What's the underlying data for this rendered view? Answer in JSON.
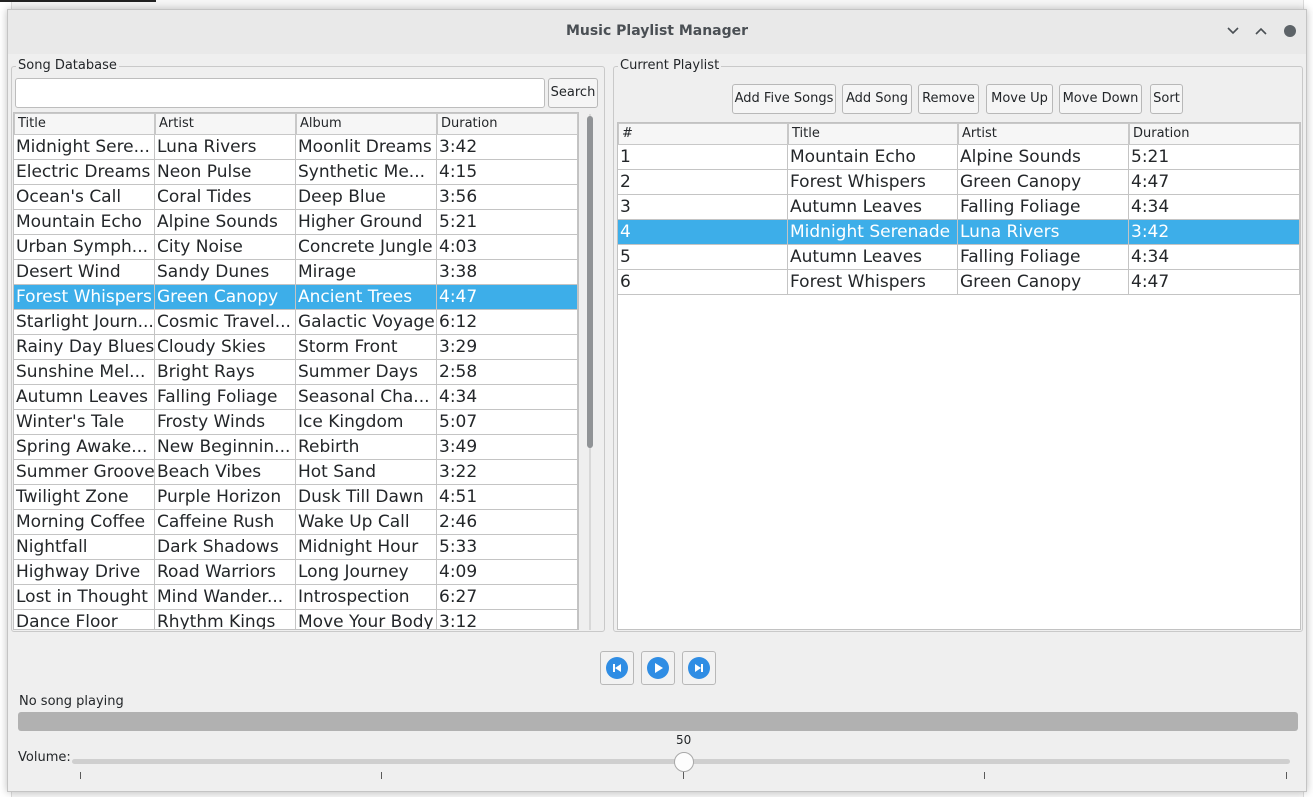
{
  "window": {
    "title": "Music Playlist Manager"
  },
  "song_database": {
    "label": "Song Database",
    "search": {
      "value": "",
      "placeholder": "",
      "button_label": "Search"
    },
    "columns": [
      "Title",
      "Artist",
      "Album",
      "Duration"
    ],
    "rows": [
      [
        "Midnight Sere...",
        "Luna Rivers",
        "Moonlit Dreams",
        "3:42"
      ],
      [
        "Electric Dreams",
        "Neon Pulse",
        "Synthetic Me...",
        "4:15"
      ],
      [
        "Ocean's Call",
        "Coral Tides",
        "Deep Blue",
        "3:56"
      ],
      [
        "Mountain Echo",
        "Alpine Sounds",
        "Higher Ground",
        "5:21"
      ],
      [
        "Urban Symph...",
        "City Noise",
        "Concrete Jungle",
        "4:03"
      ],
      [
        "Desert Wind",
        "Sandy Dunes",
        "Mirage",
        "3:38"
      ],
      [
        "Forest Whispers",
        "Green Canopy",
        "Ancient Trees",
        "4:47"
      ],
      [
        "Starlight Journ...",
        "Cosmic Travel...",
        "Galactic Voyage",
        "6:12"
      ],
      [
        "Rainy Day Blues",
        "Cloudy Skies",
        "Storm Front",
        "3:29"
      ],
      [
        "Sunshine Mel...",
        "Bright Rays",
        "Summer Days",
        "2:58"
      ],
      [
        "Autumn Leaves",
        "Falling Foliage",
        "Seasonal Cha...",
        "4:34"
      ],
      [
        "Winter's Tale",
        "Frosty Winds",
        "Ice Kingdom",
        "5:07"
      ],
      [
        "Spring Awake...",
        "New Beginnin...",
        "Rebirth",
        "3:49"
      ],
      [
        "Summer Groove",
        "Beach Vibes",
        "Hot Sand",
        "3:22"
      ],
      [
        "Twilight Zone",
        "Purple Horizon",
        "Dusk Till Dawn",
        "4:51"
      ],
      [
        "Morning Coffee",
        "Caffeine Rush",
        "Wake Up Call",
        "2:46"
      ],
      [
        "Nightfall",
        "Dark Shadows",
        "Midnight Hour",
        "5:33"
      ],
      [
        "Highway Drive",
        "Road Warriors",
        "Long Journey",
        "4:09"
      ],
      [
        "Lost in Thought",
        "Mind Wander...",
        "Introspection",
        "6:27"
      ],
      [
        "Dance Floor",
        "Rhythm Kings",
        "Move Your Body",
        "3:12"
      ]
    ],
    "selected_index": 6
  },
  "current_playlist": {
    "label": "Current Playlist",
    "buttons": [
      "Add Five Songs",
      "Add Song",
      "Remove",
      "Move Up",
      "Move Down",
      "Sort"
    ],
    "columns": [
      "#",
      "Title",
      "Artist",
      "Duration"
    ],
    "rows": [
      [
        "1",
        "Mountain Echo",
        "Alpine Sounds",
        "5:21"
      ],
      [
        "2",
        "Forest Whispers",
        "Green Canopy",
        "4:47"
      ],
      [
        "3",
        "Autumn Leaves",
        "Falling Foliage",
        "4:34"
      ],
      [
        "4",
        "Midnight Serenade",
        "Luna Rivers",
        "3:42"
      ],
      [
        "5",
        "Autumn Leaves",
        "Falling Foliage",
        "4:34"
      ],
      [
        "6",
        "Forest Whispers",
        "Green Canopy",
        "4:47"
      ]
    ],
    "selected_index": 3
  },
  "player": {
    "status": "No song playing",
    "progress": 0,
    "volume_label": "Volume:",
    "volume": "50",
    "icons": [
      "skip-previous-icon",
      "play-icon",
      "skip-next-icon"
    ]
  },
  "colors": {
    "selection": "#3daee9",
    "accent": "#2f8de4"
  }
}
